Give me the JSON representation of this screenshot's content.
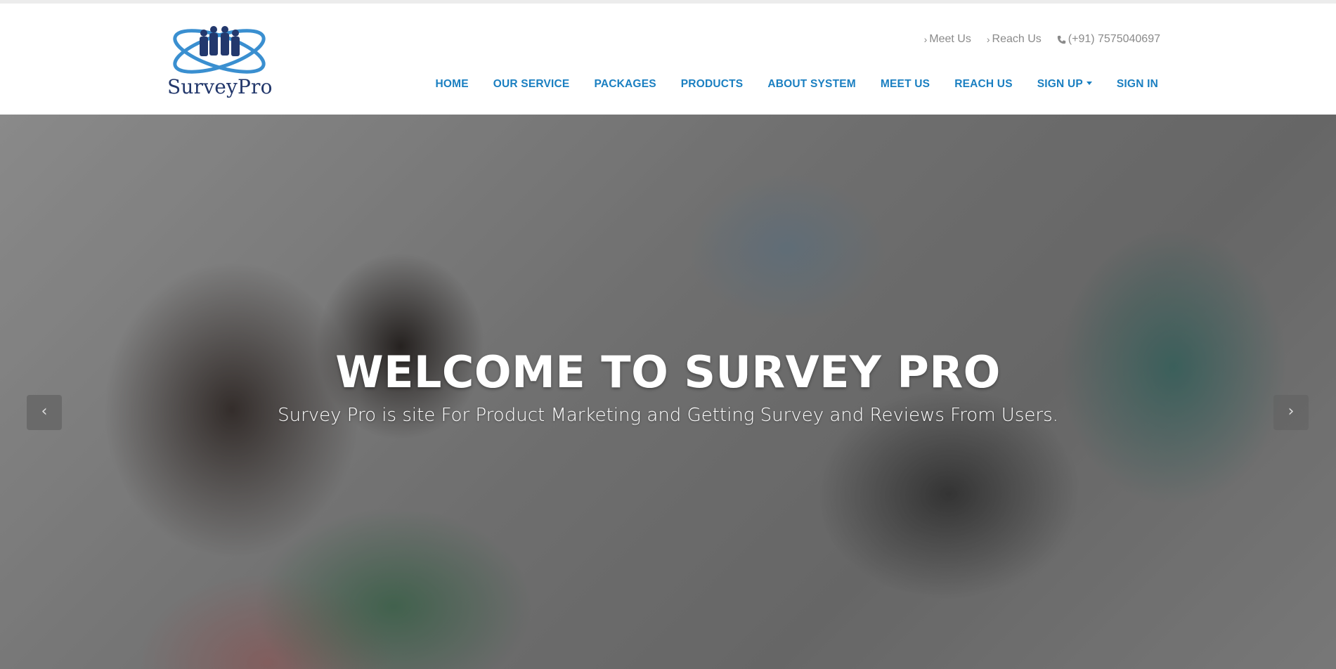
{
  "brand": {
    "name": "SurveyPro"
  },
  "top_links": [
    {
      "label": "Meet Us"
    },
    {
      "label": "Reach Us"
    },
    {
      "label": "(+91) 7575040697"
    }
  ],
  "nav": [
    {
      "label": "HOME"
    },
    {
      "label": "OUR SERVICE"
    },
    {
      "label": "PACKAGES"
    },
    {
      "label": "PRODUCTS"
    },
    {
      "label": "ABOUT SYSTEM"
    },
    {
      "label": "MEET US"
    },
    {
      "label": "REACH US"
    },
    {
      "label": "SIGN UP"
    },
    {
      "label": "SIGN IN"
    }
  ],
  "hero": {
    "title": "WELCOME TO SURVEY PRO",
    "subtitle": "Survey Pro is site For Product Marketing and Getting Survey and Reviews From Users.",
    "prev_icon": "‹",
    "next_icon": "›"
  },
  "colors": {
    "nav_text": "#1a7fc1",
    "top_link_text": "#8a8a8a",
    "logo_text": "#22376b"
  }
}
